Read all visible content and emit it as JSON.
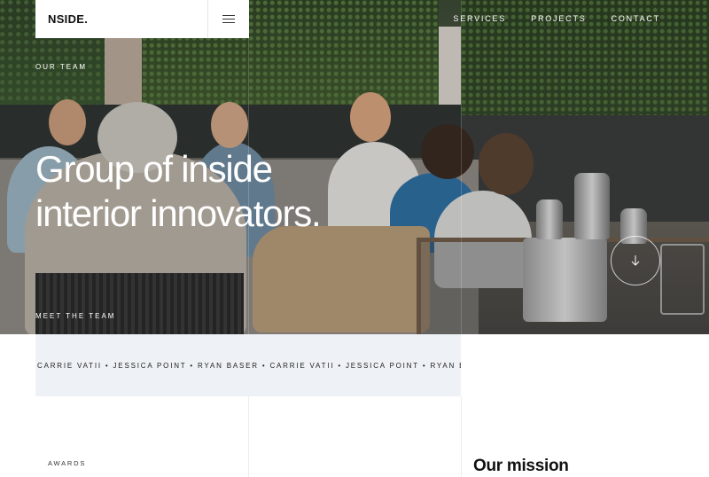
{
  "header": {
    "logo": "NSIDE.",
    "nav": [
      "SERVICES",
      "PROJECTS",
      "CONTACT"
    ]
  },
  "hero": {
    "eyebrow": "OUR TEAM",
    "title_line1": "Group of inside",
    "title_line2": "interior innovators.",
    "meet_label": "MEET THE TEAM"
  },
  "ticker": {
    "text": "CARRIE VATII • JESSICA POINT • RYAN BASER • CARRIE VATII • JESSICA POINT • RYAN BASER"
  },
  "sections": {
    "awards_label": "AWARDS",
    "mission_title": "Our mission"
  },
  "icons": {
    "menu": "hamburger-icon",
    "scroll": "arrow-down-icon"
  },
  "colors": {
    "ticker_bg": "#eef2f6",
    "logo_bg": "#ffffff",
    "hero_text": "#ffffff"
  }
}
